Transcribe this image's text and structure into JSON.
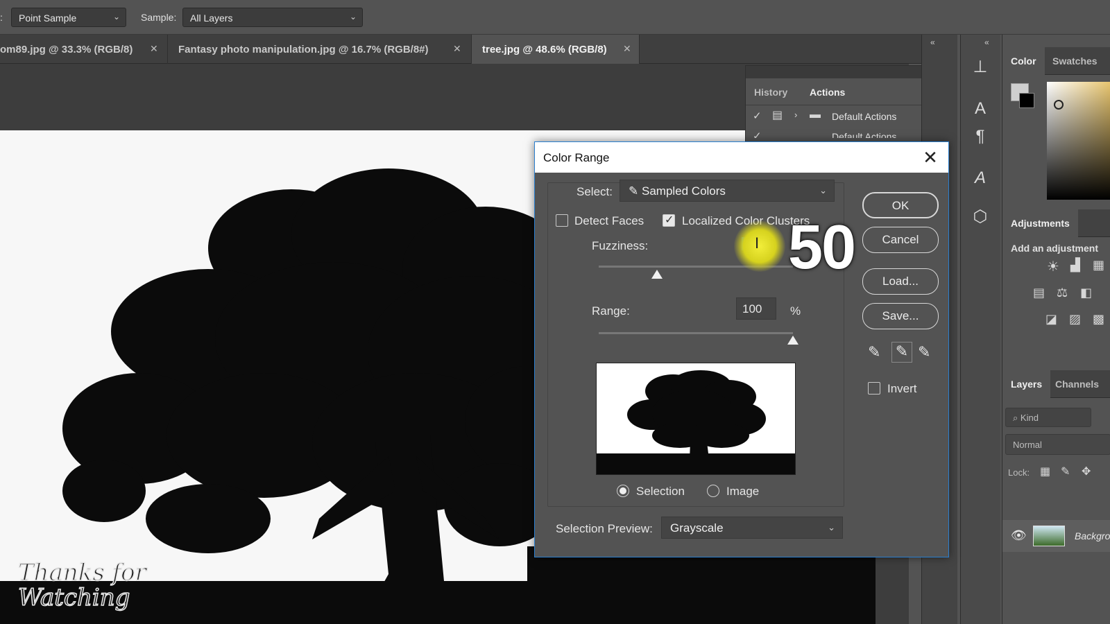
{
  "options_bar": {
    "sample_size_value": "Point Sample",
    "sample_label": "Sample:",
    "sample_value": "All Layers"
  },
  "doc_tabs": [
    {
      "label": "om89.jpg @ 33.3% (RGB/8)"
    },
    {
      "label": "Fantasy photo manipulation.jpg @ 16.7% (RGB/8#)"
    },
    {
      "label": "tree.jpg @ 48.6% (RGB/8)"
    }
  ],
  "history_panel": {
    "tab_history": "History",
    "tab_actions": "Actions",
    "rows": [
      "Default Actions",
      "Default Actions"
    ]
  },
  "right_panels": {
    "color_tab": "Color",
    "swatches_tab": "Swatches",
    "adjustments_tab": "Adjustments",
    "adjustments_hint": "Add an adjustment",
    "layers_tab": "Layers",
    "channels_tab": "Channels",
    "kind_placeholder": "Kind",
    "blend_mode": "Normal",
    "lock_label": "Lock:",
    "layer_name": "Backgro"
  },
  "dialog": {
    "title": "Color Range",
    "select_label": "Select:",
    "select_value": "Sampled Colors",
    "detect_faces_label": "Detect Faces",
    "detect_faces_checked": false,
    "localized_label": "Localized Color Clusters",
    "localized_checked": true,
    "fuzziness_label": "Fuzziness:",
    "fuzziness_value": "60",
    "fuzziness_max": 200,
    "range_label": "Range:",
    "range_value": "100",
    "range_unit": "%",
    "range_max": 100,
    "radio_selection": "Selection",
    "radio_image": "Image",
    "selected_radio": "Selection",
    "preview_label": "Selection Preview:",
    "preview_value": "Grayscale",
    "buttons": {
      "ok": "OK",
      "cancel": "Cancel",
      "load": "Load...",
      "save": "Save..."
    },
    "invert_label": "Invert",
    "invert_checked": false
  },
  "overlay": {
    "big_number": "50"
  },
  "watermark": {
    "line1": "Thanks for",
    "line2": "Watching"
  },
  "colors": {
    "panel_bg": "#535353",
    "dialog_border": "#2a7fd0",
    "highlight": "#f2ee3a"
  },
  "icons": {
    "eyedropper": "eyedropper-icon",
    "eyedropper_plus": "eyedropper-plus-icon",
    "eyedropper_minus": "eyedropper-minus-icon",
    "eye": "eye-icon",
    "folder": "folder-icon"
  }
}
